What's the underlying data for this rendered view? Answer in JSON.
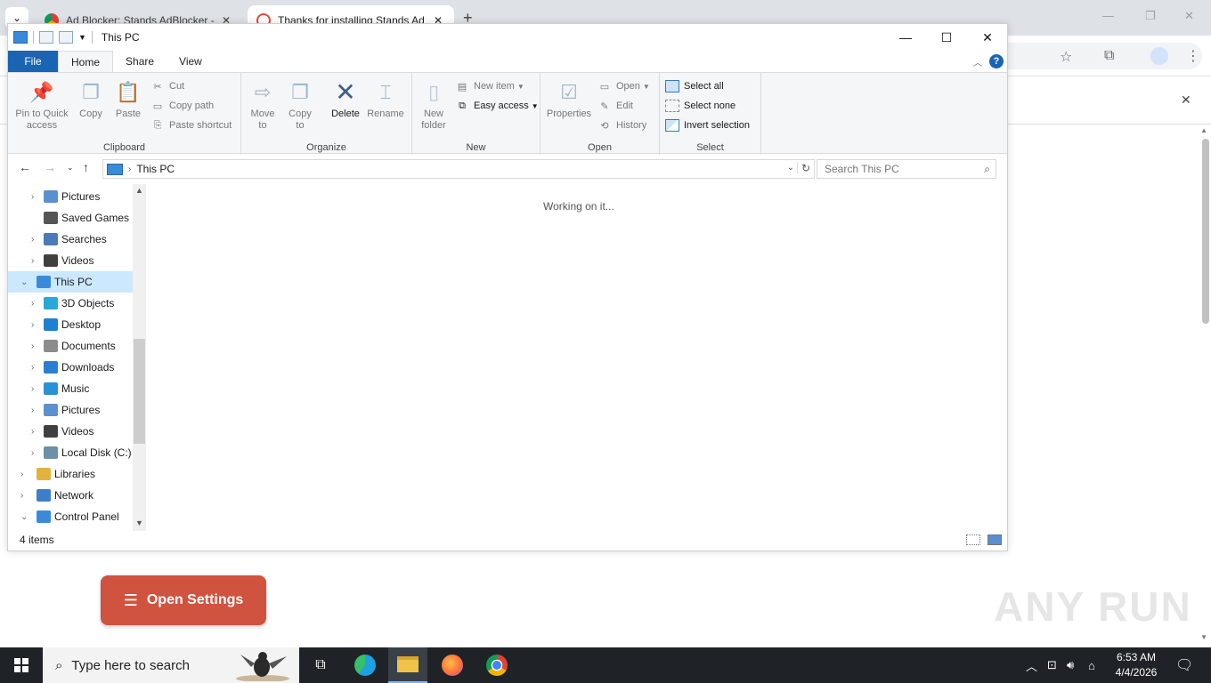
{
  "browser": {
    "tabs": [
      {
        "title": "Ad Blocker: Stands AdBlocker -",
        "close": "✕"
      },
      {
        "title": "Thanks for installing Stands Ad",
        "close": "✕"
      }
    ],
    "new_tab": "+",
    "tab_menu": "⌄",
    "infobar_close": "✕",
    "page_button": "Open Settings",
    "watermark": "ANY RUN"
  },
  "explorer": {
    "title": "This PC",
    "window_controls": {
      "minimize": "—",
      "maximize": "☐",
      "close": "✕"
    },
    "ribbon_tabs": [
      "File",
      "Home",
      "Share",
      "View"
    ],
    "ribbon": {
      "clipboard": {
        "label": "Clipboard",
        "pin": "Pin to Quick access",
        "copy": "Copy",
        "paste": "Paste",
        "cut": "Cut",
        "copy_path": "Copy path",
        "paste_shortcut": "Paste shortcut"
      },
      "organize": {
        "label": "Organize",
        "move_to": "Move to",
        "copy_to": "Copy to",
        "delete": "Delete",
        "rename": "Rename"
      },
      "new": {
        "label": "New",
        "new_folder": "New folder",
        "new_item": "New item",
        "easy_access": "Easy access"
      },
      "open": {
        "label": "Open",
        "properties": "Properties",
        "open": "Open",
        "edit": "Edit",
        "history": "History"
      },
      "select": {
        "label": "Select",
        "select_all": "Select all",
        "select_none": "Select none",
        "invert_selection": "Invert selection"
      }
    },
    "address": {
      "crumb": "This PC",
      "search_placeholder": "Search This PC"
    },
    "nav_items": [
      {
        "label": "Pictures",
        "icon": "pictures-icon",
        "color": "#5a8fd0"
      },
      {
        "label": "Saved Games",
        "icon": "saved-games-icon",
        "color": "#555555"
      },
      {
        "label": "Searches",
        "icon": "search-icon",
        "color": "#4a7ab8"
      },
      {
        "label": "Videos",
        "icon": "videos-icon",
        "color": "#404040"
      },
      {
        "label": "This PC",
        "icon": "computer-icon",
        "color": "#3b8ad9"
      },
      {
        "label": "3D Objects",
        "icon": "3d-objects-icon",
        "color": "#29a8d8"
      },
      {
        "label": "Desktop",
        "icon": "desktop-icon",
        "color": "#1f7fd0"
      },
      {
        "label": "Documents",
        "icon": "documents-icon",
        "color": "#8c8c8c"
      },
      {
        "label": "Downloads",
        "icon": "downloads-icon",
        "color": "#2a7fd4"
      },
      {
        "label": "Music",
        "icon": "music-icon",
        "color": "#2a90d8"
      },
      {
        "label": "Pictures",
        "icon": "pictures-icon",
        "color": "#5a8fd0"
      },
      {
        "label": "Videos",
        "icon": "videos-icon",
        "color": "#404040"
      },
      {
        "label": "Local Disk (C:)",
        "icon": "drive-icon",
        "color": "#6d8fa8"
      },
      {
        "label": "Libraries",
        "icon": "libraries-icon",
        "color": "#e2b33c"
      },
      {
        "label": "Network",
        "icon": "network-icon",
        "color": "#3b7fc8"
      },
      {
        "label": "Control Panel",
        "icon": "control-panel-icon",
        "color": "#3b8ad9"
      }
    ],
    "status_text": "Working on it...",
    "item_count": "4 items"
  },
  "taskbar": {
    "search_placeholder": "Type here to search",
    "time": "6:53 AM",
    "date": "4/4/2026"
  }
}
